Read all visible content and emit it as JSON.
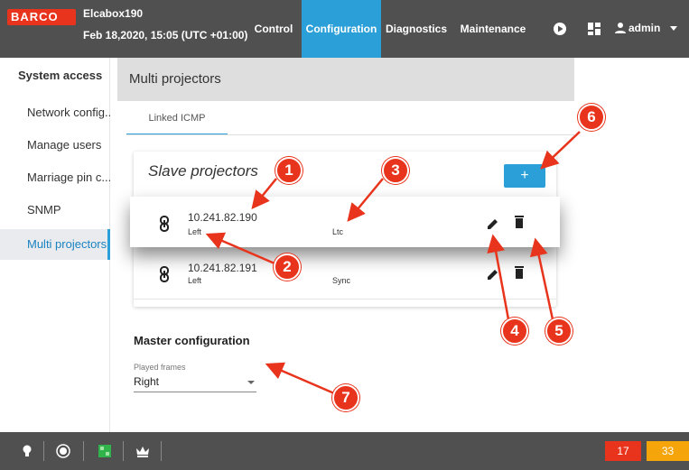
{
  "header": {
    "brand": "BARCO",
    "device_name": "Elcabox190",
    "datetime": "Feb 18,2020, 15:05 (UTC +01:00)",
    "tabs": [
      {
        "label": "Control"
      },
      {
        "label": "Configuration",
        "active": true
      },
      {
        "label": "Diagnostics"
      },
      {
        "label": "Maintenance"
      }
    ],
    "user": "admin",
    "icons": [
      "play-icon",
      "grid-icon",
      "user-icon",
      "caret-down-icon"
    ]
  },
  "sidebar": {
    "heading": "System access",
    "items": [
      {
        "label": "Network config..."
      },
      {
        "label": "Manage users"
      },
      {
        "label": "Marriage pin c..."
      },
      {
        "label": "SNMP"
      },
      {
        "label": "Multi projectors",
        "active": true
      }
    ]
  },
  "main": {
    "title": "Multi projectors",
    "subtab": "Linked ICMP",
    "slave_card": {
      "title": "Slave projectors",
      "add_label": "+",
      "rows": [
        {
          "ip": "10.241.82.190",
          "position": "Left",
          "sync": "Ltc"
        },
        {
          "ip": "10.241.82.191",
          "position": "Left",
          "sync": "Sync"
        }
      ]
    },
    "master": {
      "title": "Master configuration",
      "field_label": "Played frames",
      "field_value": "Right"
    }
  },
  "footer": {
    "icons": [
      "lightbulb-icon",
      "shutter-icon",
      "test-pattern-icon",
      "crown-icon"
    ],
    "badge_red": "17",
    "badge_orange": "33"
  },
  "callouts": [
    "1",
    "2",
    "3",
    "4",
    "5",
    "6",
    "7"
  ],
  "colors": {
    "accent": "#2a9fd8",
    "brand_red": "#e8341c",
    "bar": "#505050",
    "badge_orange": "#f5a40a"
  }
}
